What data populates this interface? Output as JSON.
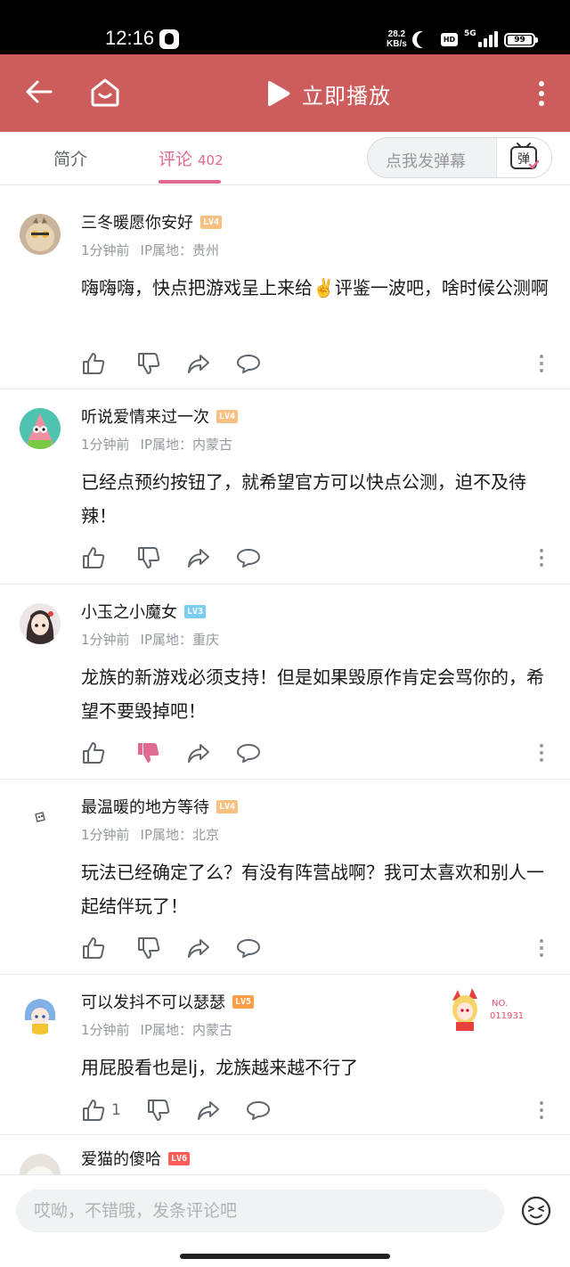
{
  "status_bar": {
    "time": "12:16",
    "net_speed_value": "28.2",
    "net_speed_unit": "KB/s",
    "hd_label": "HD",
    "network": "5G",
    "battery": "99"
  },
  "app_bar": {
    "play_label": "立即播放",
    "icons": [
      "back-arrow-icon",
      "home-icon",
      "play-icon",
      "more-vertical-icon"
    ]
  },
  "tabs": {
    "intro_label": "简介",
    "comments_label": "评论",
    "comments_count": "402",
    "danmaku_placeholder": "点我发弹幕",
    "danmaku_button": "弹"
  },
  "colors": {
    "app_bar": "#cd5c5c",
    "accent_pink": "#e16891",
    "lv4": "#f8c181",
    "lv3": "#7bcdef",
    "lv5": "#ff9e44",
    "lv6": "#ff5d55",
    "disliked": "#e16891"
  },
  "comments": [
    {
      "username": "三冬暖愿你安好",
      "level": "LV4",
      "time": "1分钟前",
      "ip": "IP属地：贵州",
      "text": "嗨嗨嗨，快点把游戏呈上来给✌️评鉴一波吧，啥时候公测啊",
      "like_count": "",
      "disliked": false
    },
    {
      "username": "听说爱情来过一次",
      "level": "LV4",
      "time": "1分钟前",
      "ip": "IP属地：内蒙古",
      "text": "已经点预约按钮了，就希望官方可以快点公测，迫不及待辣！",
      "like_count": "",
      "disliked": false
    },
    {
      "username": "小玉之小魔女",
      "level": "LV3",
      "time": "1分钟前",
      "ip": "IP属地：重庆",
      "text": "龙族的新游戏必须支持！但是如果毁原作肯定会骂你的，希望不要毁掉吧！",
      "like_count": "",
      "disliked": true
    },
    {
      "username": "最温暖的地方等待",
      "level": "LV4",
      "time": "1分钟前",
      "ip": "IP属地：北京",
      "text": "玩法已经确定了么？有没有阵营战啊？我可太喜欢和别人一起结伴玩了！",
      "like_count": "",
      "disliked": false
    },
    {
      "username": "可以发抖不可以瑟瑟",
      "level": "LV5",
      "time": "1分钟前",
      "ip": "IP属地：内蒙古",
      "text": "用屁股看也是lj，龙族越来越不行了",
      "like_count": "1",
      "disliked": false,
      "fan_badge_no": "NO.",
      "fan_badge_num": "011931"
    },
    {
      "username": "爱猫的傻哈",
      "level": "LV6"
    }
  ],
  "bottom_bar": {
    "input_placeholder": "哎呦，不错哦，发条评论吧"
  }
}
